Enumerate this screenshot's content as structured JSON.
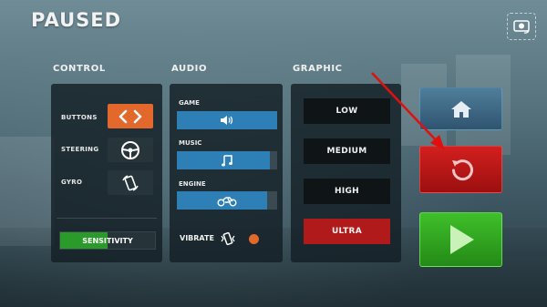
{
  "title": "PAUSED",
  "sections": {
    "control": "CONTROL",
    "audio": "AUDIO",
    "graphic": "GRAPHIC"
  },
  "control": {
    "rows": [
      {
        "label": "BUTTONS",
        "icon": "left-right-arrows-icon",
        "selected": true
      },
      {
        "label": "STEERING",
        "icon": "steering-wheel-icon",
        "selected": false
      },
      {
        "label": "GYRO",
        "icon": "gyro-rotate-icon",
        "selected": false
      }
    ],
    "sensitivity_label": "SENSITIVITY",
    "sensitivity_level": 0.5
  },
  "audio": {
    "channels": [
      {
        "label": "GAME",
        "icon": "speaker-icon",
        "level": 1.0
      },
      {
        "label": "MUSIC",
        "icon": "music-note-icon",
        "level": 0.93
      },
      {
        "label": "ENGINE",
        "icon": "motorbike-icon",
        "level": 0.9
      }
    ],
    "vibrate_label": "VIBRATE",
    "vibrate_on": true
  },
  "graphic": {
    "options": [
      "LOW",
      "MEDIUM",
      "HIGH",
      "ULTRA"
    ],
    "selected": "ULTRA"
  },
  "actions": {
    "home": "home-icon",
    "restart": "restart-icon",
    "play": "play-icon"
  },
  "colors": {
    "accent_orange": "#e2682c",
    "audio_blue": "#2e7fb6",
    "selected_red": "#b11a1a",
    "restart_red": "#c51a1a",
    "play_green": "#33a822",
    "home_blue": "#3e6a88",
    "annotation_arrow": "#e01010"
  }
}
